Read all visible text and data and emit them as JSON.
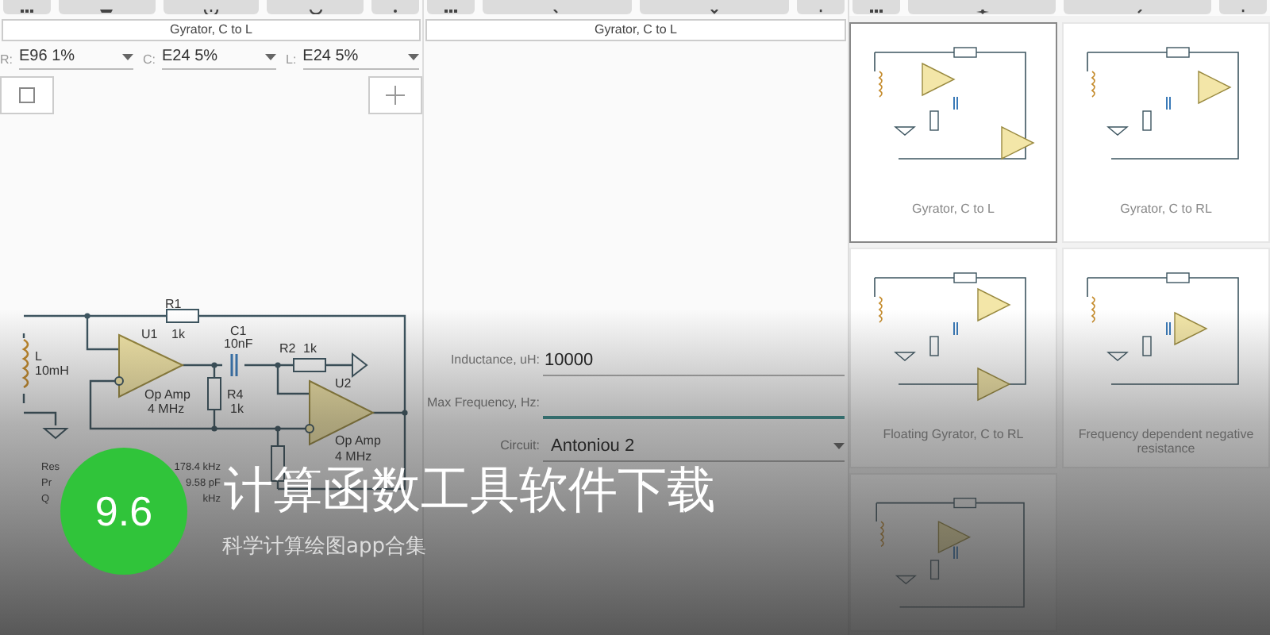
{
  "schematic_panel": {
    "title": "Gyrator, C to L",
    "series_selectors": [
      {
        "label": "R:",
        "value": "E96 1%"
      },
      {
        "label": "C:",
        "value": "E24 5%"
      },
      {
        "label": "L:",
        "value": "E24 5%"
      }
    ],
    "component_labels": [
      "R1",
      "U1",
      "1k",
      "C1",
      "10nF",
      "R2",
      "1k",
      "L",
      "10mH",
      "U2",
      "Op Amp",
      "4 MHz",
      "R4",
      "1k",
      "Op Amp",
      "4 MHz"
    ],
    "results": [
      {
        "name": "Res",
        "value": "178.4 kHz"
      },
      {
        "name": "Pr",
        "value": "9.58 pF"
      },
      {
        "name": "Q",
        "value": "kHz"
      }
    ]
  },
  "form_panel": {
    "title": "Gyrator, C to L",
    "fields": [
      {
        "kind": "text",
        "label": "Inductance, uH:",
        "value": "10000",
        "focused": false
      },
      {
        "kind": "text",
        "label": "Max Frequency, Hz:",
        "focused": true
      },
      {
        "kind": "dropdown",
        "label": "Circuit:",
        "value": "Antoniou 2"
      }
    ]
  },
  "gallery": {
    "cards": [
      {
        "label": "Gyrator, C to L",
        "selected": true
      },
      {
        "label": "Gyrator, C to RL",
        "selected": false
      },
      {
        "label": "Floating Gyrator, C to RL",
        "selected": false
      },
      {
        "label": "Frequency dependent negative resistance",
        "selected": false
      },
      {
        "selected": false
      }
    ]
  },
  "banner": {
    "rating": "9.6",
    "title": "计算函数工具软件下载",
    "subtitle": "科学计算绘图app合集"
  }
}
